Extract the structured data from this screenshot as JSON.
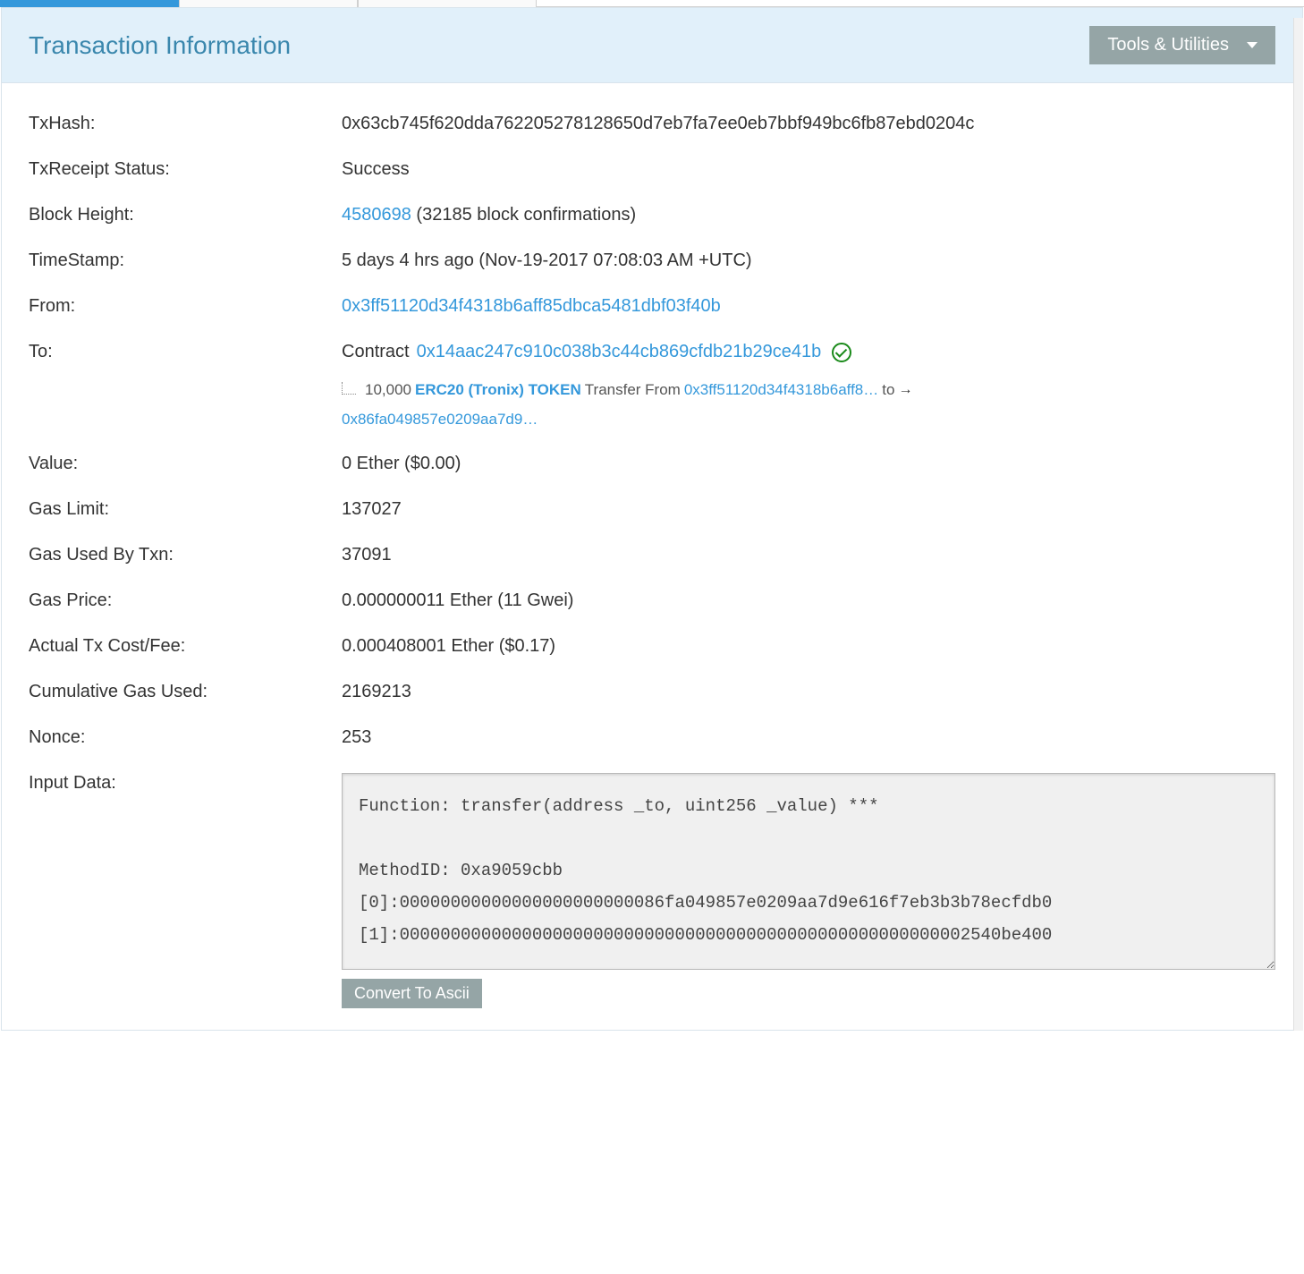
{
  "header": {
    "title": "Transaction Information",
    "tools_label": "Tools & Utilities"
  },
  "fields": {
    "txhash": {
      "label": "TxHash:",
      "value": "0x63cb745f620dda762205278128650d7eb7fa7ee0eb7bbf949bc6fb87ebd0204c"
    },
    "receipt": {
      "label": "TxReceipt Status:",
      "value": "Success"
    },
    "block": {
      "label": "Block Height:",
      "link": "4580698",
      "confirmations": " (32185 block confirmations)"
    },
    "timestamp": {
      "label": "TimeStamp:",
      "value": "5 days 4 hrs ago (Nov-19-2017 07:08:03 AM +UTC)"
    },
    "from": {
      "label": "From:",
      "address": "0x3ff51120d34f4318b6aff85dbca5481dbf03f40b"
    },
    "to": {
      "label": "To:",
      "prefix": "Contract ",
      "contract": "0x14aac247c910c038b3c44cb869cfdb21b29ce41b",
      "transfer_amount": " 10,000 ",
      "token_link": "ERC20 (Tronix) TOKEN",
      "transfer_text": " Transfer From ",
      "from_short": "0x3ff51120d34f4318b6aff8…",
      "to_text": " to ",
      "to_short": "0x86fa049857e0209aa7d9…"
    },
    "value": {
      "label": "Value:",
      "value": "0 Ether ($0.00)"
    },
    "gaslimit": {
      "label": "Gas Limit:",
      "value": "137027"
    },
    "gasused": {
      "label": "Gas Used By Txn:",
      "value": "37091"
    },
    "gasprice": {
      "label": "Gas Price:",
      "value": "0.000000011 Ether (11 Gwei)"
    },
    "txcost": {
      "label": "Actual Tx Cost/Fee:",
      "value": "0.000408001 Ether ($0.17)"
    },
    "cumgas": {
      "label": "Cumulative Gas Used:",
      "value": "2169213"
    },
    "nonce": {
      "label": "Nonce:",
      "value": "253"
    },
    "inputdata": {
      "label": "Input Data:",
      "value": "Function: transfer(address _to, uint256 _value) ***\n\nMethodID: 0xa9059cbb\n[0]:00000000000000000000000086fa049857e0209aa7d9e616f7eb3b3b78ecfdb0\n[1]:00000000000000000000000000000000000000000000000000000002540be400"
    },
    "convert_label": "Convert To Ascii"
  }
}
